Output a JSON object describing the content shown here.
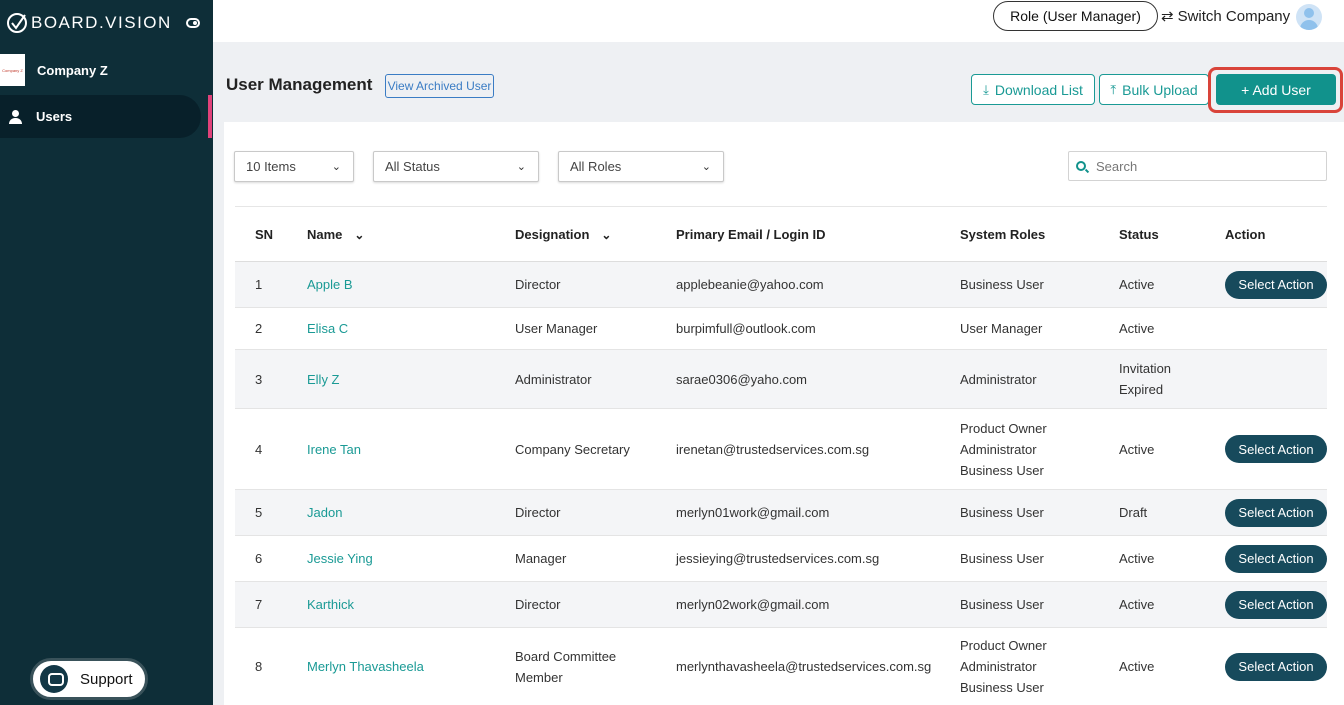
{
  "sidebar": {
    "logo_text": "BOARD.VISION",
    "company_thumb_text": "Company Z",
    "company_name": "Company Z",
    "nav_users_label": "Users",
    "support_label": "Support"
  },
  "topbar": {
    "role_label": "Role (User Manager)",
    "switch_company_label": "Switch Company"
  },
  "header": {
    "title": "User Management",
    "archived_label": "View Archived User",
    "download_label": "Download List",
    "bulk_upload_label": "Bulk Upload",
    "add_user_label": "+ Add User"
  },
  "filters": {
    "items": "10 Items",
    "status": "All Status",
    "roles": "All Roles",
    "search_placeholder": "Search"
  },
  "table": {
    "headers": {
      "sn": "SN",
      "name": "Name",
      "designation": "Designation",
      "email": "Primary Email / Login ID",
      "roles": "System Roles",
      "status": "Status",
      "action": "Action"
    },
    "action_label": "Select Action",
    "rows": [
      {
        "sn": "1",
        "name": "Apple B",
        "designation": [
          "Director"
        ],
        "email": "applebeanie@yahoo.com",
        "roles": [
          "Business User"
        ],
        "status": [
          "Active"
        ],
        "action": true
      },
      {
        "sn": "2",
        "name": "Elisa C",
        "designation": [
          "User Manager"
        ],
        "email": "burpimfull@outlook.com",
        "roles": [
          "User Manager"
        ],
        "status": [
          "Active"
        ],
        "action": false
      },
      {
        "sn": "3",
        "name": "Elly Z",
        "designation": [
          "Administrator"
        ],
        "email": "sarae0306@yaho.com",
        "roles": [
          "Administrator"
        ],
        "status": [
          "Invitation",
          "Expired"
        ],
        "action": false
      },
      {
        "sn": "4",
        "name": "Irene Tan",
        "designation": [
          "Company Secretary"
        ],
        "email": "irenetan@trustedservices.com.sg",
        "roles": [
          "Product Owner",
          "Administrator",
          "Business User"
        ],
        "status": [
          "Active"
        ],
        "action": true
      },
      {
        "sn": "5",
        "name": "Jadon",
        "designation": [
          "Director"
        ],
        "email": "merlyn01work@gmail.com",
        "roles": [
          "Business User"
        ],
        "status": [
          "Draft"
        ],
        "action": true
      },
      {
        "sn": "6",
        "name": "Jessie Ying",
        "designation": [
          "Manager"
        ],
        "email": "jessieying@trustedservices.com.sg",
        "roles": [
          "Business User"
        ],
        "status": [
          "Active"
        ],
        "action": true
      },
      {
        "sn": "7",
        "name": "Karthick",
        "designation": [
          "Director"
        ],
        "email": "merlyn02work@gmail.com",
        "roles": [
          "Business User"
        ],
        "status": [
          "Active"
        ],
        "action": true
      },
      {
        "sn": "8",
        "name": "Merlyn Thavasheela",
        "designation": [
          "Board Committee",
          "Member"
        ],
        "email": "merlynthavasheela@trustedservices.com.sg",
        "roles": [
          "Product Owner",
          "Administrator",
          "Business User"
        ],
        "status": [
          "Active"
        ],
        "action": true
      }
    ]
  },
  "colors": {
    "sidebar_bg": "#0e2e38",
    "accent_teal": "#11928c",
    "action_button": "#174a5c",
    "highlight_red": "#d9443a",
    "nav_indicator": "#e0427a"
  }
}
